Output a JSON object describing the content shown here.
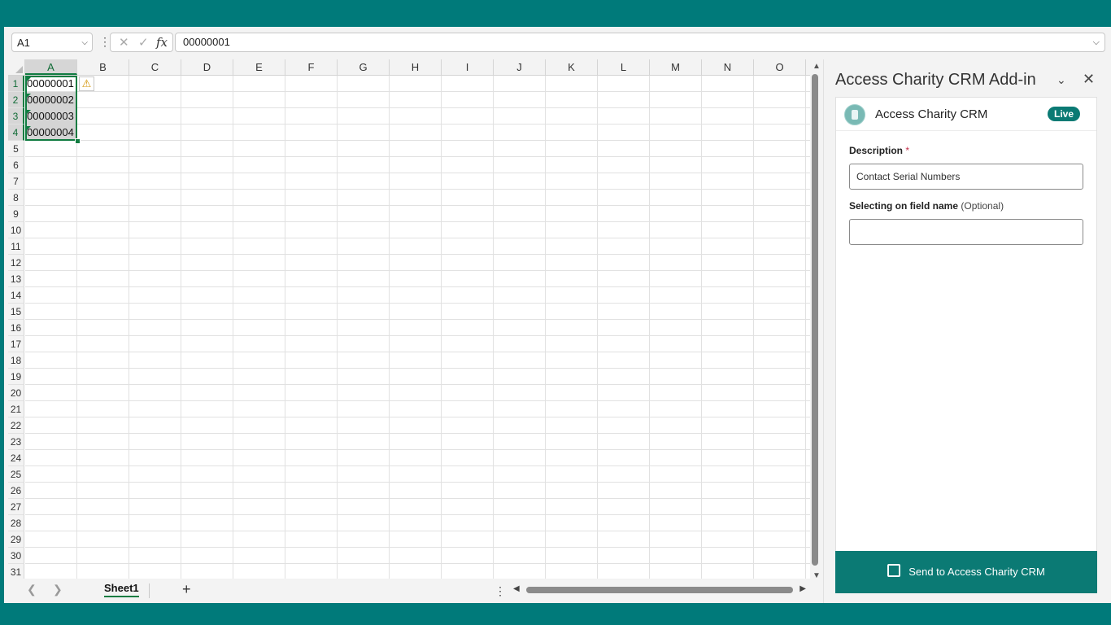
{
  "formula_bar": {
    "name_box": "A1",
    "cancel_glyph": "✕",
    "enter_glyph": "✓",
    "fx_glyph": "fx",
    "formula": "00000001"
  },
  "columns": [
    "A",
    "B",
    "C",
    "D",
    "E",
    "F",
    "G",
    "H",
    "I",
    "J",
    "K",
    "L",
    "M",
    "N",
    "O"
  ],
  "rows": [
    "1",
    "2",
    "3",
    "4",
    "5",
    "6",
    "7",
    "8",
    "9",
    "10",
    "11",
    "12",
    "13",
    "14",
    "15",
    "16",
    "17",
    "18",
    "19",
    "20",
    "21",
    "22",
    "23",
    "24",
    "25",
    "26",
    "27",
    "28",
    "29",
    "30",
    "31"
  ],
  "cells": [
    {
      "ref": "A1",
      "value": "00000001"
    },
    {
      "ref": "A2",
      "value": "00000002"
    },
    {
      "ref": "A3",
      "value": "00000003"
    },
    {
      "ref": "A4",
      "value": "00000004"
    }
  ],
  "sheet_tabs": [
    "Sheet1"
  ],
  "add_sheet": "+",
  "task_pane": {
    "title": "Access Charity CRM Add-in",
    "card_title": "Access Charity CRM",
    "status_badge": "Live",
    "description_label": "Description",
    "description_required": "*",
    "description_value": "Contact Serial Numbers",
    "field_name_label": "Selecting on field name",
    "field_name_optional": "(Optional)",
    "field_name_value": "",
    "send_button": "Send to Access Charity CRM"
  },
  "colors": {
    "accent": "#0b7a74",
    "excel_green": "#107c41",
    "background": "#007a7a"
  }
}
